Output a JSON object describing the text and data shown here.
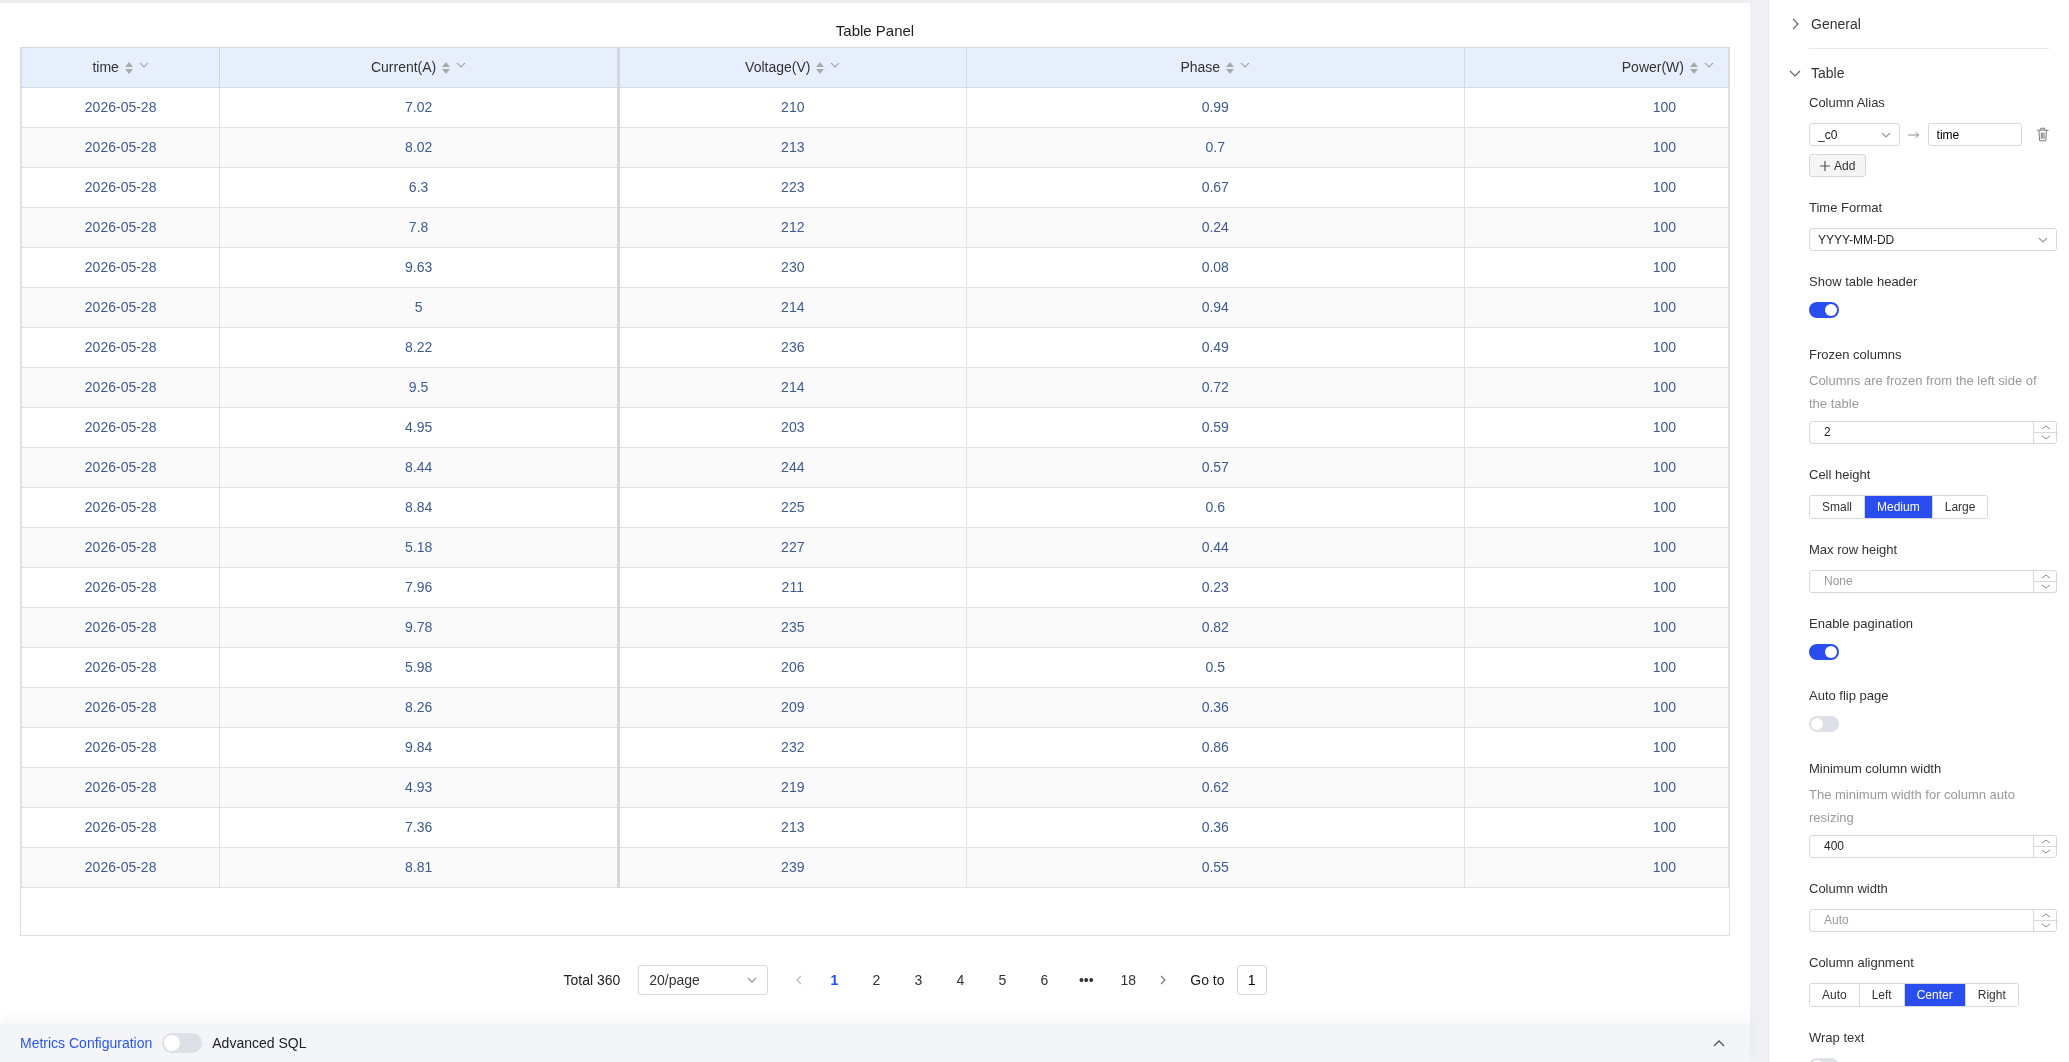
{
  "panel": {
    "title": "Table Panel"
  },
  "table": {
    "columns": [
      {
        "label": "time"
      },
      {
        "label": "Current(A)"
      },
      {
        "label": "Voltage(V)"
      },
      {
        "label": "Phase"
      },
      {
        "label": "Power(W)"
      }
    ],
    "rows": [
      [
        "2026-05-28",
        "7.02",
        "210",
        "0.99",
        "100"
      ],
      [
        "2026-05-28",
        "8.02",
        "213",
        "0.7",
        "100"
      ],
      [
        "2026-05-28",
        "6.3",
        "223",
        "0.67",
        "100"
      ],
      [
        "2026-05-28",
        "7.8",
        "212",
        "0.24",
        "100"
      ],
      [
        "2026-05-28",
        "9.63",
        "230",
        "0.08",
        "100"
      ],
      [
        "2026-05-28",
        "5",
        "214",
        "0.94",
        "100"
      ],
      [
        "2026-05-28",
        "8.22",
        "236",
        "0.49",
        "100"
      ],
      [
        "2026-05-28",
        "9.5",
        "214",
        "0.72",
        "100"
      ],
      [
        "2026-05-28",
        "4.95",
        "203",
        "0.59",
        "100"
      ],
      [
        "2026-05-28",
        "8.44",
        "244",
        "0.57",
        "100"
      ],
      [
        "2026-05-28",
        "8.84",
        "225",
        "0.6",
        "100"
      ],
      [
        "2026-05-28",
        "5.18",
        "227",
        "0.44",
        "100"
      ],
      [
        "2026-05-28",
        "7.96",
        "211",
        "0.23",
        "100"
      ],
      [
        "2026-05-28",
        "9.78",
        "235",
        "0.82",
        "100"
      ],
      [
        "2026-05-28",
        "5.98",
        "206",
        "0.5",
        "100"
      ],
      [
        "2026-05-28",
        "8.26",
        "209",
        "0.36",
        "100"
      ],
      [
        "2026-05-28",
        "9.84",
        "232",
        "0.86",
        "100"
      ],
      [
        "2026-05-28",
        "4.93",
        "219",
        "0.62",
        "100"
      ],
      [
        "2026-05-28",
        "7.36",
        "213",
        "0.36",
        "100"
      ],
      [
        "2026-05-28",
        "8.81",
        "239",
        "0.55",
        "100"
      ]
    ]
  },
  "pagination": {
    "total": "Total 360",
    "page_size": "20/page",
    "pages": [
      {
        "label": "1",
        "selected": true,
        "kind": "page"
      },
      {
        "label": "2",
        "selected": false,
        "kind": "page"
      },
      {
        "label": "3",
        "selected": false,
        "kind": "page"
      },
      {
        "label": "4",
        "selected": false,
        "kind": "page"
      },
      {
        "label": "5",
        "selected": false,
        "kind": "page"
      },
      {
        "label": "6",
        "selected": false,
        "kind": "page"
      },
      {
        "label": "•••",
        "kind": "ellipsis"
      },
      {
        "label": "18",
        "selected": false,
        "kind": "page"
      }
    ],
    "goto_label": "Go to",
    "goto_value": "1"
  },
  "bottom_bar": {
    "link": "Metrics Configuration",
    "toggle": {
      "label": "Advanced SQL",
      "on": false
    }
  },
  "settings": {
    "sections": [
      {
        "title": "General",
        "expanded": false
      },
      {
        "title": "Table",
        "expanded": true,
        "fields": [
          {
            "kind": "alias",
            "label": "Column Alias",
            "from": "_c0",
            "to": "time",
            "add": "Add"
          },
          {
            "kind": "select",
            "label": "Time Format",
            "value": "YYYY-MM-DD"
          },
          {
            "kind": "toggle",
            "label": "Show table header",
            "on": true
          },
          {
            "kind": "number",
            "label": "Frozen columns",
            "description": "Columns are frozen from the left side of the table",
            "value": "2"
          },
          {
            "kind": "segmented",
            "label": "Cell height",
            "options": [
              {
                "label": "Small",
                "selected": false
              },
              {
                "label": "Medium",
                "selected": true
              },
              {
                "label": "Large",
                "selected": false
              }
            ]
          },
          {
            "kind": "number",
            "label": "Max row height",
            "placeholder": "None"
          },
          {
            "kind": "toggle",
            "label": "Enable pagination",
            "on": true
          },
          {
            "kind": "toggle",
            "label": "Auto flip page",
            "on": false
          },
          {
            "kind": "number",
            "label": "Minimum column width",
            "description": "The minimum width for column auto resizing",
            "value": "400"
          },
          {
            "kind": "number",
            "label": "Column width",
            "placeholder": "Auto"
          },
          {
            "kind": "segmented",
            "label": "Column alignment",
            "options": [
              {
                "label": "Auto",
                "selected": false
              },
              {
                "label": "Left",
                "selected": false
              },
              {
                "label": "Center",
                "selected": true
              },
              {
                "label": "Right",
                "selected": false
              }
            ]
          },
          {
            "kind": "toggle",
            "label": "Wrap text",
            "on": false
          }
        ]
      }
    ]
  }
}
